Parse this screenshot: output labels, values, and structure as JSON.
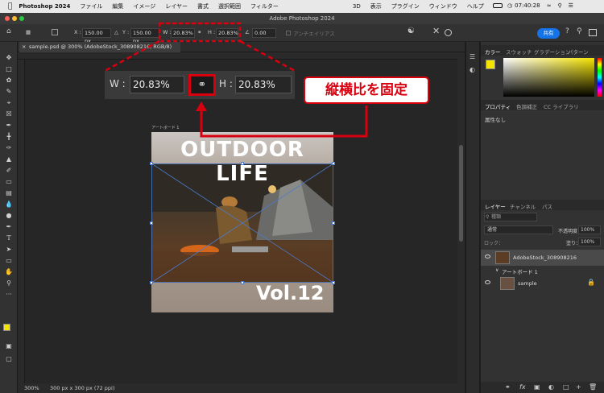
{
  "menubar": {
    "app": "Photoshop 2024",
    "items": [
      "ファイル",
      "編集",
      "イメージ",
      "レイヤー",
      "書式",
      "選択範囲",
      "フィルター",
      "3D",
      "表示",
      "プラグイン",
      "ウィンドウ",
      "ヘルプ"
    ],
    "clock": "07:40:28"
  },
  "titlebar": {
    "title": "Adobe Photoshop 2024"
  },
  "options": {
    "x_label": "X :",
    "x_value": "150.00 px",
    "y_label": "Y :",
    "y_value": "150.00 px",
    "w_label": "W :",
    "w_value": "20.83%",
    "h_label": "H :",
    "h_value": "20.83%",
    "angle_value": "0.00",
    "antialias": "アンチエイリアス",
    "share": "共有"
  },
  "document": {
    "tab": "sample.psd @ 300% (AdobeStock_308908216, RGB/8)"
  },
  "zoom_callout": {
    "w_label": "W :",
    "w_value": "20.83%",
    "h_label": "H :",
    "h_value": "20.83%"
  },
  "annotation": {
    "text": "縦横比を固定"
  },
  "artboard": {
    "label": "アートボード 1",
    "title": "OUTDOOR LIFE",
    "vol": "Vol.12"
  },
  "status": {
    "zoom": "300%",
    "info": "300 px x 300 px (72 ppi)"
  },
  "panels": {
    "color_tabs": [
      "カラー",
      "スウォッチ",
      "グラデーション",
      "パターン"
    ],
    "prop_tabs": [
      "プロパティ",
      "色調補正",
      "CC ライブラリ"
    ],
    "prop_text": "属性なし",
    "layer_tabs": [
      "レイヤー",
      "チャンネル",
      "パス"
    ],
    "search": "種類",
    "blend": "通常",
    "opacity_label": "不透明度：",
    "opacity": "100%",
    "lock_label": "ロック：",
    "fill_label": "塗り：",
    "fill": "100%",
    "layers": [
      "AdobeStock_308908216",
      "アートボード 1",
      "sample"
    ]
  },
  "colors": {
    "accent": "#1473e6",
    "annotation": "#d8000f",
    "foreground": "#f5e400"
  }
}
